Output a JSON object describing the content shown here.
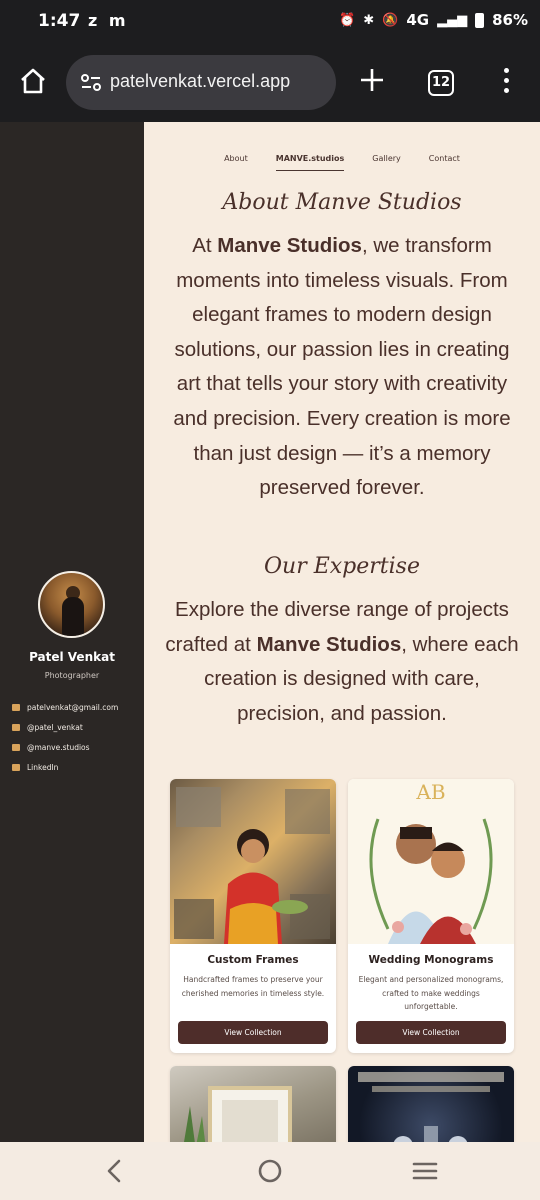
{
  "status_bar": {
    "time": "1:47",
    "app_icons": "z m",
    "network": "4G",
    "battery": "86%"
  },
  "browser": {
    "url": "patelvenkat.vercel.app",
    "tab_count": "12"
  },
  "sidebar": {
    "name": "Patel Venkat",
    "role": "Photographer",
    "contacts": [
      {
        "label": "patelvenkat@gmail.com",
        "icon": "mail-icon"
      },
      {
        "label": "@patel_venkat",
        "icon": "instagram-icon"
      },
      {
        "label": "@manve.studios",
        "icon": "instagram-icon"
      },
      {
        "label": "LinkedIn",
        "icon": "linkedin-icon"
      }
    ]
  },
  "nav": {
    "tabs": [
      "About",
      "MANVE.studios",
      "Gallery",
      "Contact"
    ],
    "active": "MANVE.studios"
  },
  "about": {
    "heading": "About Manve Studios",
    "text_before": "At ",
    "brand": "Manve Studios",
    "text_after": ", we transform moments into timeless visuals. From elegant frames to modern design solutions, our passion lies in creating art that tells your story with creativity and precision. Every creation is more than just design — it’s a memory preserved forever."
  },
  "expertise": {
    "heading": "Our Expertise",
    "text_before": "Explore the diverse range of projects crafted at ",
    "brand": "Manve Studios",
    "text_after": ", where each creation is designed with care, precision, and passion."
  },
  "cards": [
    {
      "title": "Custom Frames",
      "description": "Handcrafted frames to preserve your cherished memories in timeless style.",
      "button": "View Collection"
    },
    {
      "title": "Wedding Monograms",
      "description": "Elegant and personalized monograms, crafted to make weddings unforgettable.",
      "button": "View Collection"
    }
  ],
  "colors": {
    "accent": "#4e2d2a",
    "page_bg": "#f7ece0",
    "sidebar_bg": "#2b2725"
  }
}
